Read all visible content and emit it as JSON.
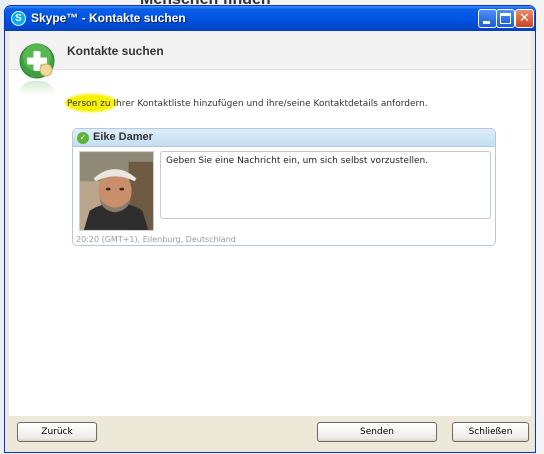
{
  "background": {
    "heading": "Menschen finden"
  },
  "window": {
    "title": "Skype™ - Kontakte suchen",
    "app_icon_letter": "S",
    "controls": {
      "close_glyph": "✕"
    }
  },
  "header": {
    "title": "Kontakte suchen",
    "icon": "add-contact-icon"
  },
  "intro": {
    "text": "Person zu Ihrer Kontaktliste hinzufügen und ihre/seine Kontaktdetails anfordern."
  },
  "contact": {
    "name": "Eike Damer",
    "status_icon": "online-check-icon",
    "message": "Geben Sie eine Nachricht ein, um sich selbst vorzustellen.",
    "meta": "20:20 (GMT+1), Eilenburg, Deutschland"
  },
  "buttons": {
    "back": "Zurück",
    "send": "Senden",
    "close": "Schließen"
  },
  "colors": {
    "titlebar": "#0054e3",
    "highlight": "#f9f200",
    "online": "#5db43a",
    "card_border": "#b5c8dc"
  }
}
